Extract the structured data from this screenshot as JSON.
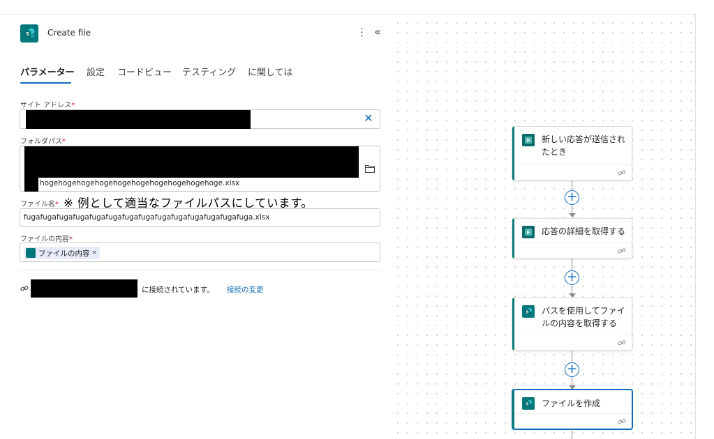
{
  "header": {
    "title": "Create file",
    "more_icon": "more-vertical-icon",
    "collapse_icon": "double-chevron-left-icon"
  },
  "tabs": [
    {
      "label": "パラメーター",
      "active": true
    },
    {
      "label": "設定"
    },
    {
      "label": "コードビュー"
    },
    {
      "label": "テスティング"
    },
    {
      "label": "に関しては"
    }
  ],
  "fields": {
    "site_address": {
      "label": "サイト アドレス",
      "required": "*"
    },
    "folder_path": {
      "label": "フォルダパス",
      "required": "*",
      "value": "hogehogehogehogehogehogehogehogehogehoge.xlsx"
    },
    "file_name": {
      "label": "ファイル名",
      "required": "*",
      "value": "fugafugafugafugafugafugafugafugafugafugafugafugafugafuga.xlsx"
    },
    "file_content": {
      "label": "ファイルの内容",
      "required": "*",
      "token": "ファイルの内容",
      "token_remove": "×"
    }
  },
  "annotation": "※ 例として適当なファイルパスにしています。",
  "connection": {
    "text": "に接続されています。",
    "change_link": "接続の変更"
  },
  "flow": {
    "nodes": [
      {
        "title": "新しい応答が送信されたとき",
        "icon": "forms-icon",
        "color": "#0b6a6a"
      },
      {
        "title": "応答の詳細を取得する",
        "icon": "forms-icon",
        "color": "#0b6a6a"
      },
      {
        "title": "パスを使用してファイルの内容を取得する",
        "icon": "sharepoint-icon",
        "color": "#03787c"
      },
      {
        "title": "ファイルを作成",
        "icon": "sharepoint-icon",
        "color": "#03787c",
        "selected": true
      }
    ],
    "add_label": "+"
  },
  "colors": {
    "accent": "#0f6cbd",
    "sharepoint": "#03787c",
    "required": "#c50f1f"
  }
}
